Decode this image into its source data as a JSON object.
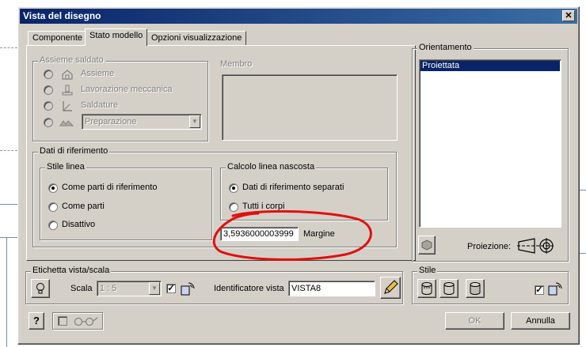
{
  "window": {
    "title": "Vista del disegno",
    "close_glyph": "✕"
  },
  "tabs": [
    {
      "label": "Componente"
    },
    {
      "label": "Stato modello"
    },
    {
      "label": "Opzioni visualizzazione"
    }
  ],
  "assieme_saldato": {
    "label": "Assieme saldato",
    "options": [
      {
        "label": "Assieme",
        "icon": "assembly-icon"
      },
      {
        "label": "Lavorazione meccanica",
        "icon": "machining-icon"
      },
      {
        "label": "Saldature",
        "icon": "weld-icon"
      }
    ],
    "preparation_select": {
      "value": "Preparazione",
      "icon": "preparation-icon"
    }
  },
  "membro": {
    "label": "Membro"
  },
  "dati_riferimento": {
    "label": "Dati di riferimento",
    "stile_linea": {
      "label": "Stile linea",
      "options": [
        {
          "label": "Come parti di riferimento",
          "selected": true
        },
        {
          "label": "Come parti",
          "selected": false
        },
        {
          "label": "Disattivo",
          "selected": false
        }
      ]
    },
    "calcolo": {
      "label": "Calcolo linea nascosta",
      "options": [
        {
          "label": "Dati di riferimento separati",
          "selected": true
        },
        {
          "label": "Tutti i corpi",
          "selected": false
        }
      ]
    },
    "margin_value": "3,5936000003999",
    "margin_label": "Margine"
  },
  "orientamento": {
    "label": "Orientamento",
    "items": [
      {
        "label": "Proiettata",
        "selected": true
      }
    ],
    "projection_label": "Proiezione:"
  },
  "etichetta": {
    "label": "Etichetta vista/scala",
    "scale_label": "Scala",
    "scale_value": "1 : 5",
    "identifier_label": "Identificatore vista",
    "identifier_value": "VISTA8"
  },
  "stile": {
    "label": "Stile"
  },
  "footer": {
    "help_glyph": "?",
    "ok_label": "OK",
    "cancel_label": "Annulla"
  },
  "colors": {
    "selection": "#0a246a",
    "annotation_red": "#e01010",
    "title_start": "#0a246a",
    "title_end": "#3a6ea5"
  }
}
